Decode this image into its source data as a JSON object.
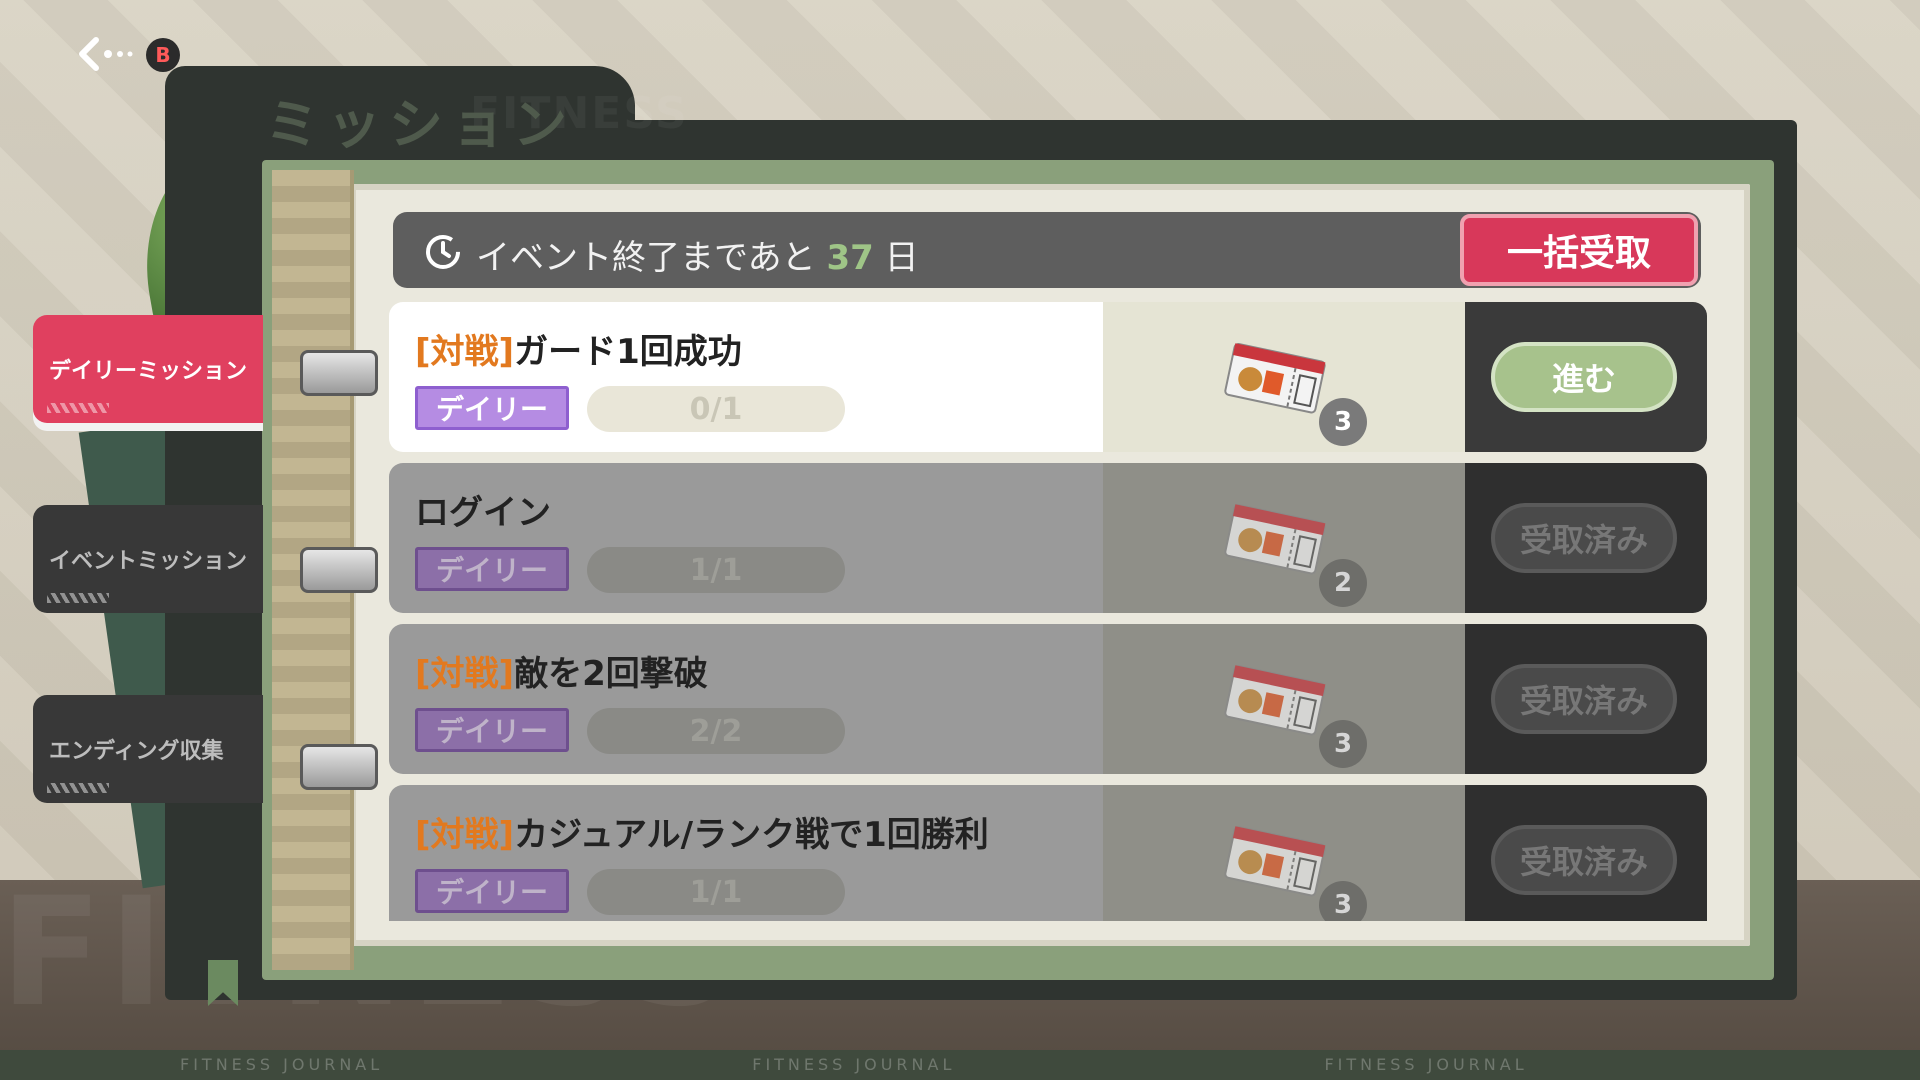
{
  "header": {
    "title": "ミッション",
    "title_bg": "FITNESS",
    "back_key": "B"
  },
  "event_bar": {
    "prefix": "イベント終了まであと",
    "days": "37",
    "suffix": "日",
    "claim_all_label": "一括受取"
  },
  "tabs": [
    {
      "label": "デイリーミッション",
      "active": true
    },
    {
      "label": "イベントミッション",
      "active": false
    },
    {
      "label": "エンディング収集",
      "active": false
    }
  ],
  "missions": [
    {
      "tag": "[対戦]",
      "title": "ガード1回成功",
      "badge": "デイリー",
      "progress": "0/1",
      "reward_count": "3",
      "action": "進む",
      "status": "in_progress"
    },
    {
      "tag": "",
      "title": "ログイン",
      "badge": "デイリー",
      "progress": "1/1",
      "reward_count": "2",
      "action": "受取済み",
      "status": "claimed"
    },
    {
      "tag": "[対戦]",
      "title": "敵を2回撃破",
      "badge": "デイリー",
      "progress": "2/2",
      "reward_count": "3",
      "action": "受取済み",
      "status": "claimed"
    },
    {
      "tag": "[対戦]",
      "title": "カジュアル/ランク戦で1回勝利",
      "badge": "デイリー",
      "progress": "1/1",
      "reward_count": "3",
      "action": "受取済み",
      "status": "claimed"
    }
  ],
  "footer": {
    "text": "FITNESS JOURNAL"
  },
  "colors": {
    "accent_red": "#d8385a",
    "tag_orange": "#e2791f",
    "days_green": "#9fc587",
    "daily_purple": "#b58ce3",
    "go_green": "#a7c28c"
  },
  "icons": {
    "back": "back-arrow-icon",
    "clock": "clock-icon",
    "reward": "food-ticket-icon"
  }
}
